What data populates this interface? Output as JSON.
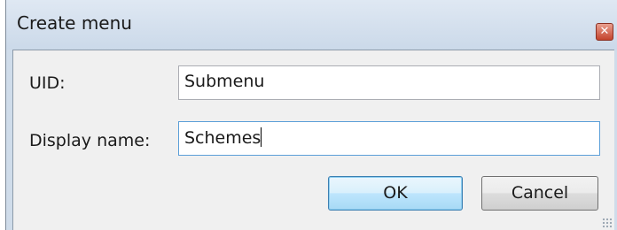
{
  "window": {
    "title": "Create menu",
    "close_icon": "close-icon"
  },
  "form": {
    "uid_label": "UID:",
    "uid_value": "Submenu",
    "display_name_label": "Display name:",
    "display_name_value": "Schemes"
  },
  "buttons": {
    "ok_label": "OK",
    "cancel_label": "Cancel"
  },
  "colors": {
    "title_bar": "#cfdcea",
    "client_background": "#f0f0f0",
    "default_button_border": "#3c7fb1",
    "close_button": "#c4432c"
  }
}
